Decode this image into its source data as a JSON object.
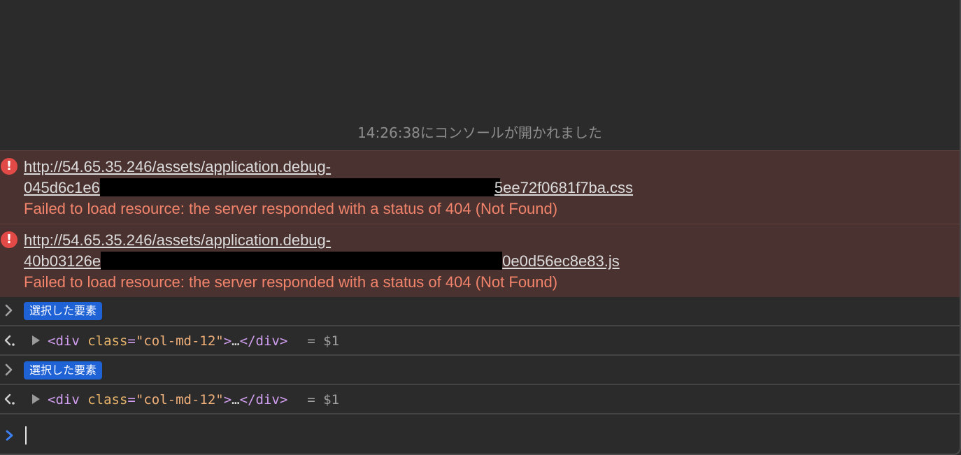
{
  "console": {
    "opened_note": "14:26:38にコンソールが開かれました",
    "errors": [
      {
        "url_line1": "http://54.65.35.246/assets/application.debug-",
        "url_prefix": "045d6c1e6",
        "url_suffix": "5ee72f0681f7ba.css",
        "message": "Failed to load resource: the server responded with a status of 404 (Not Found)",
        "icon": "error-icon"
      },
      {
        "url_line1": "http://54.65.35.246/assets/application.debug-",
        "url_prefix": "40b03126e",
        "url_suffix": "0e0d56ec8e83.js",
        "message": "Failed to load resource: the server responded with a status of 404 (Not Found)",
        "icon": "error-icon"
      }
    ],
    "entries": [
      {
        "kind": "input",
        "badge": "選択した要素"
      },
      {
        "kind": "result",
        "tag_open": "<div",
        "attr_name": "class",
        "attr_eq": "=",
        "attr_value": "\"col-md-12\"",
        "tag_close": ">",
        "ellipsis": "…",
        "end_tag": "</div>",
        "ref": "= $1"
      },
      {
        "kind": "input",
        "badge": "選択した要素"
      },
      {
        "kind": "result",
        "tag_open": "<div",
        "attr_name": "class",
        "attr_eq": "=",
        "attr_value": "\"col-md-12\"",
        "tag_close": ">",
        "ellipsis": "…",
        "end_tag": "</div>",
        "ref": "= $1"
      }
    ],
    "colors": {
      "background": "#2b2b2b",
      "error_row": "#4a3230",
      "error_text": "#f2846b",
      "error_icon": "#e24a47",
      "badge": "#1f62d6",
      "prompt": "#3d7ff5"
    }
  }
}
